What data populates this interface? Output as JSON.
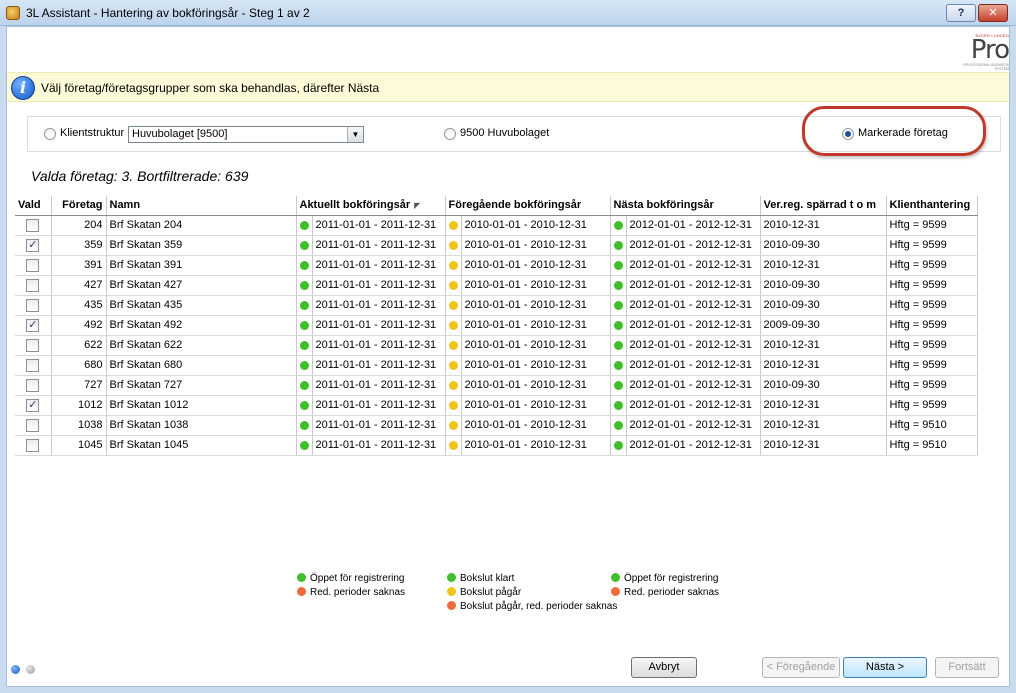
{
  "window": {
    "title": "3L Assistant - Hantering av bokföringsår - Steg 1 av 2",
    "help_label": "?",
    "close_label": "✕"
  },
  "logo": {
    "small_text": "BJÖRN LUNDÉN",
    "brand": "Pro",
    "tagline": "PROFESSIONAL BUSINESS SYSTEM"
  },
  "banner": {
    "text": "Välj företag/företagsgrupper som ska behandlas, därefter Nästa"
  },
  "filter": {
    "klientstruktur_label": "Klientstruktur",
    "klientstruktur_value": "Huvubolaget [9500]",
    "group_label": "9500 Huvubolaget",
    "markerade_label": "Markerade företag",
    "selected": "markerade"
  },
  "summary": "Valda företag: 3. Bortfiltrerade: 639",
  "table": {
    "headers": {
      "vald": "Vald",
      "foretag": "Företag",
      "namn": "Namn",
      "aktuellt": "Aktuellt bokföringsår",
      "foregaende": "Föregående bokföringsår",
      "nasta": "Nästa bokföringsår",
      "verreg": "Ver.reg. spärrad t o m",
      "klient": "Klienthantering"
    },
    "sort_mark": "◤",
    "rows": [
      {
        "checked": false,
        "nr": "204",
        "namn": "Brf Skatan 204",
        "aktuellt": "2011-01-01 - 2011-12-31",
        "foregaende": "2010-01-01 - 2010-12-31",
        "nasta": "2012-01-01 - 2012-12-31",
        "verreg": "2010-12-31",
        "klient": "Hftg = 9599"
      },
      {
        "checked": true,
        "nr": "359",
        "namn": "Brf Skatan 359",
        "aktuellt": "2011-01-01 - 2011-12-31",
        "foregaende": "2010-01-01 - 2010-12-31",
        "nasta": "2012-01-01 - 2012-12-31",
        "verreg": "2010-09-30",
        "klient": "Hftg = 9599"
      },
      {
        "checked": false,
        "nr": "391",
        "namn": "Brf Skatan 391",
        "aktuellt": "2011-01-01 - 2011-12-31",
        "foregaende": "2010-01-01 - 2010-12-31",
        "nasta": "2012-01-01 - 2012-12-31",
        "verreg": "2010-12-31",
        "klient": "Hftg = 9599"
      },
      {
        "checked": false,
        "nr": "427",
        "namn": "Brf Skatan 427",
        "aktuellt": "2011-01-01 - 2011-12-31",
        "foregaende": "2010-01-01 - 2010-12-31",
        "nasta": "2012-01-01 - 2012-12-31",
        "verreg": "2010-09-30",
        "klient": "Hftg = 9599"
      },
      {
        "checked": false,
        "nr": "435",
        "namn": "Brf Skatan 435",
        "aktuellt": "2011-01-01 - 2011-12-31",
        "foregaende": "2010-01-01 - 2010-12-31",
        "nasta": "2012-01-01 - 2012-12-31",
        "verreg": "2010-09-30",
        "klient": "Hftg = 9599"
      },
      {
        "checked": true,
        "nr": "492",
        "namn": "Brf Skatan 492",
        "aktuellt": "2011-01-01 - 2011-12-31",
        "foregaende": "2010-01-01 - 2010-12-31",
        "nasta": "2012-01-01 - 2012-12-31",
        "verreg": "2009-09-30",
        "klient": "Hftg = 9599"
      },
      {
        "checked": false,
        "nr": "622",
        "namn": "Brf Skatan 622",
        "aktuellt": "2011-01-01 - 2011-12-31",
        "foregaende": "2010-01-01 - 2010-12-31",
        "nasta": "2012-01-01 - 2012-12-31",
        "verreg": "2010-12-31",
        "klient": "Hftg = 9599"
      },
      {
        "checked": false,
        "nr": "680",
        "namn": "Brf Skatan 680",
        "aktuellt": "2011-01-01 - 2011-12-31",
        "foregaende": "2010-01-01 - 2010-12-31",
        "nasta": "2012-01-01 - 2012-12-31",
        "verreg": "2010-12-31",
        "klient": "Hftg = 9599"
      },
      {
        "checked": false,
        "nr": "727",
        "namn": "Brf Skatan 727",
        "aktuellt": "2011-01-01 - 2011-12-31",
        "foregaende": "2010-01-01 - 2010-12-31",
        "nasta": "2012-01-01 - 2012-12-31",
        "verreg": "2010-09-30",
        "klient": "Hftg = 9599"
      },
      {
        "checked": true,
        "nr": "1012",
        "namn": "Brf Skatan 1012",
        "aktuellt": "2011-01-01 - 2011-12-31",
        "foregaende": "2010-01-01 - 2010-12-31",
        "nasta": "2012-01-01 - 2012-12-31",
        "verreg": "2010-12-31",
        "klient": "Hftg = 9599"
      },
      {
        "checked": false,
        "nr": "1038",
        "namn": "Brf Skatan 1038",
        "aktuellt": "2011-01-01 - 2011-12-31",
        "foregaende": "2010-01-01 - 2010-12-31",
        "nasta": "2012-01-01 - 2012-12-31",
        "verreg": "2010-12-31",
        "klient": "Hftg = 9510"
      },
      {
        "checked": false,
        "nr": "1045",
        "namn": "Brf Skatan 1045",
        "aktuellt": "2011-01-01 - 2011-12-31",
        "foregaende": "2010-01-01 - 2010-12-31",
        "nasta": "2012-01-01 - 2012-12-31",
        "verreg": "2010-12-31",
        "klient": "Hftg = 9510"
      }
    ]
  },
  "legend": {
    "col1": [
      {
        "color": "green",
        "text": "Öppet för registrering"
      },
      {
        "color": "red",
        "text": "Red. perioder saknas"
      }
    ],
    "col2": [
      {
        "color": "green",
        "text": "Bokslut klart"
      },
      {
        "color": "yellow",
        "text": "Bokslut pågår"
      },
      {
        "color": "red",
        "text": "Bokslut pågår, red. perioder saknas"
      }
    ],
    "col3": [
      {
        "color": "green",
        "text": "Öppet för registrering"
      },
      {
        "color": "red",
        "text": "Red. perioder saknas"
      }
    ]
  },
  "footer": {
    "avbryt": "Avbryt",
    "foregaende": "< Föregående",
    "nasta": "Nästa >",
    "fortsatt": "Fortsätt"
  },
  "colors": {
    "green": "#3fbf2a",
    "yellow": "#f0c419",
    "red": "#f06a3a",
    "accent": "#1458c4",
    "highlight_ring": "#c0392b"
  }
}
